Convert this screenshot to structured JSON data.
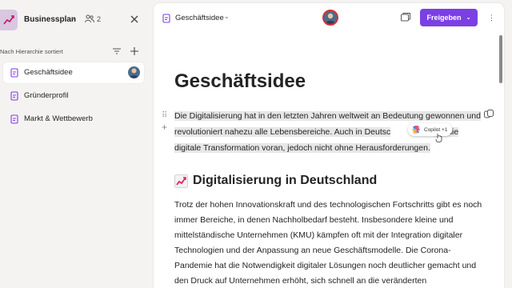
{
  "sidebar": {
    "workspace_name": "Businessplan",
    "members_count": "2",
    "sort_label": "Nach Hierarchie sortiert",
    "items": [
      {
        "label": "Geschäftsidee",
        "active": true
      },
      {
        "label": "Gründerprofil",
        "active": false
      },
      {
        "label": "Markt & Wettbewerb",
        "active": false
      }
    ]
  },
  "topbar": {
    "doc_title": "Geschäftsidee",
    "share_label": "Freigeben"
  },
  "document": {
    "title": "Geschäftsidee",
    "para1_before": "Die Digitalisierung hat in den letzten Jahren weltweit an Bedeutung gewonnen und revolutioniert nahezu alle Lebensbereiche. Auch in Deutsc",
    "para1_after": "ket die digitale Transformation voran, jedoch nicht ohne Herausforderungen.",
    "copilot_label": "Copilot +1",
    "heading2": "Digitalisierung in Deutschland",
    "para2": "Trotz der hohen Innovationskraft und des technologischen Fortschritts gibt es noch immer Bereiche, in denen Nachholbedarf besteht. Insbesondere kleine und mittelständische Unternehmen (KMU) kämpfen oft mit der Integration digitaler Technologien und der Anpassung an neue Geschäftsmodelle. Die Corona-Pandemie hat die Notwendigkeit digitaler Lösungen noch deutlicher gemacht und den Druck auf Unternehmen erhöht, sich schnell an die veränderten"
  },
  "colors": {
    "accent": "#7b3fe4",
    "page_icon": "#7b3fe4",
    "collab_ring": "#d13438"
  },
  "icons": {
    "workspace": "chart-trend-icon",
    "members": "people-icon",
    "close": "close-icon",
    "filter": "filter-icon",
    "add": "plus-icon",
    "page": "loop-page-icon",
    "copilot": "copilot-icon"
  }
}
